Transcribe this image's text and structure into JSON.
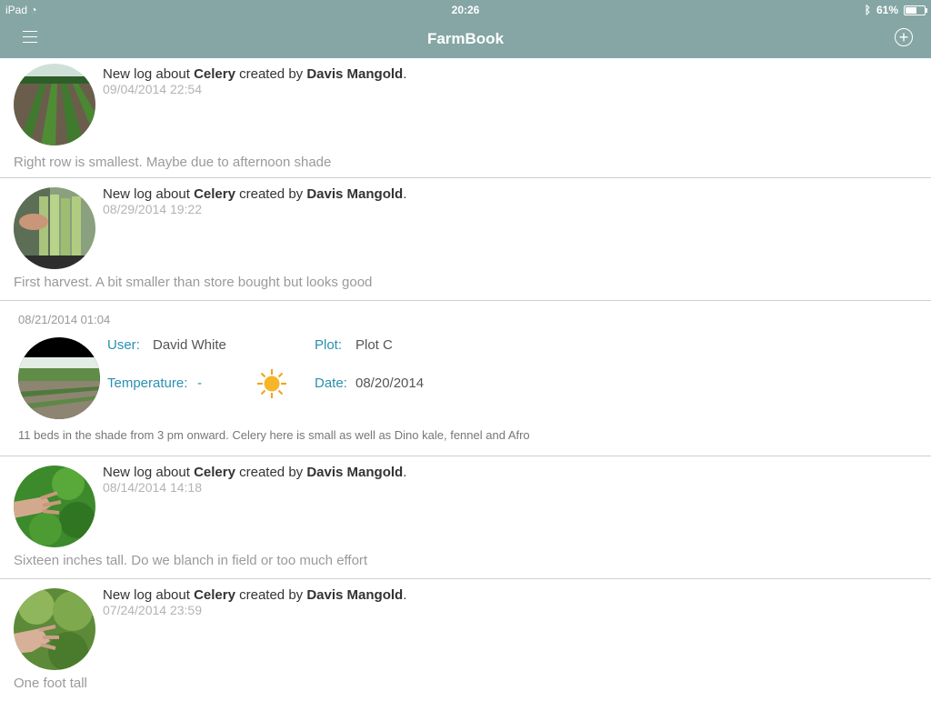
{
  "status": {
    "device": "iPad",
    "time": "20:26",
    "battery": "61%",
    "battery_level": 0.61
  },
  "nav": {
    "title": "FarmBook"
  },
  "entries": [
    {
      "prefix": "New log about ",
      "crop": "Celery",
      "mid": " created by ",
      "author": "Davis Mangold",
      "suffix": ".",
      "timestamp": "09/04/2014 22:54",
      "note": "Right row is smallest.  Maybe due to afternoon shade"
    },
    {
      "prefix": "New log about ",
      "crop": "Celery",
      "mid": " created by ",
      "author": "Davis Mangold",
      "suffix": ".",
      "timestamp": "08/29/2014 19:22",
      "note": "First harvest. A bit smaller than store bought but looks good"
    },
    {
      "prefix": "New log about ",
      "crop": "Celery",
      "mid": " created by ",
      "author": "Davis Mangold",
      "suffix": ".",
      "timestamp": "08/14/2014 14:18",
      "note": "Sixteen inches tall. Do we blanch in field or too much effort"
    },
    {
      "prefix": "New log about ",
      "crop": "Celery",
      "mid": " created by ",
      "author": "Davis Mangold",
      "suffix": ".",
      "timestamp": "07/24/2014 23:59",
      "note": "One foot tall"
    }
  ],
  "detail": {
    "timestamp": "08/21/2014 01:04",
    "user_label": "User:",
    "user": "David White",
    "plot_label": "Plot:",
    "plot": "Plot C",
    "temp_label": "Temperature:",
    "temp": "-",
    "date_label": "Date:",
    "date": "08/20/2014",
    "weather_icon": "sun-icon",
    "note": "11 beds in the shade from 3 pm onward. Celery here is small as well as Dino kale, fennel and Afro"
  }
}
